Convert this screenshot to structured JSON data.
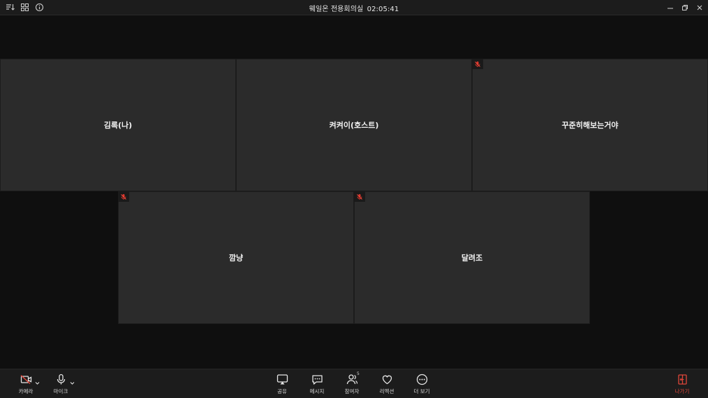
{
  "titlebar": {
    "title": "웨일온 전용회의실",
    "timer": "02:05:41",
    "left_icons": [
      "sort-icon",
      "grid-icon",
      "info-icon"
    ],
    "window_controls": [
      "minimize-icon",
      "restore-icon",
      "close-icon"
    ]
  },
  "participants": [
    {
      "name": "김록(나)",
      "muted": false
    },
    {
      "name": "켜켜이(호스트)",
      "muted": false
    },
    {
      "name": "꾸준히해보는거야",
      "muted": true
    },
    {
      "name": "깜냥",
      "muted": true
    },
    {
      "name": "달려조",
      "muted": true
    }
  ],
  "toolbar": {
    "camera_label": "카메라",
    "mic_label": "마이크",
    "share_label": "공유",
    "message_label": "메시지",
    "participants_label": "참여자",
    "participants_count": "5",
    "reaction_label": "리액션",
    "more_label": "더 보기",
    "leave_label": "나가기"
  },
  "colors": {
    "background": "#0f0f0f",
    "tile": "#2b2b2b",
    "bar": "#1c1c1c",
    "danger": "#e0463a"
  }
}
